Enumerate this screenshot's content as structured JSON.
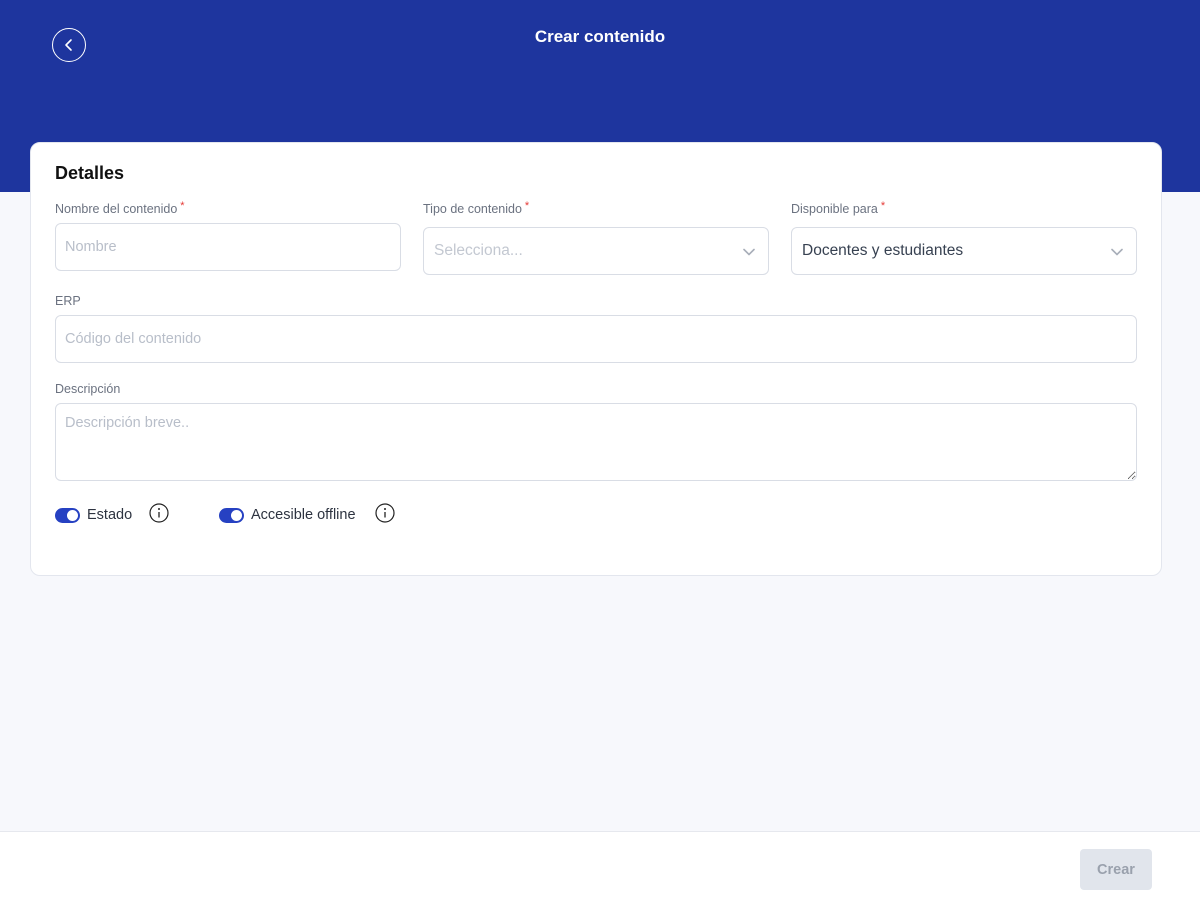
{
  "header": {
    "title": "Crear contenido",
    "back_icon": "chevron-left-icon",
    "background_color": "#1e359e"
  },
  "card": {
    "section_title": "Detalles",
    "fields": {
      "nombre": {
        "label": "Nombre del contenido",
        "required_mark": "*",
        "placeholder": "Nombre",
        "value": ""
      },
      "tipo": {
        "label": "Tipo de contenido",
        "required_mark": "*",
        "placeholder": "Selecciona...",
        "icon": "chevron-down-icon"
      },
      "disponible": {
        "label": "Disponible para",
        "required_mark": "*",
        "value": "Docentes y estudiantes",
        "icon": "chevron-down-icon"
      },
      "erp": {
        "label": "ERP",
        "placeholder": "Código del contenido",
        "value": ""
      },
      "descripcion": {
        "label": "Descripción",
        "placeholder": "Descripción breve..",
        "value": ""
      }
    },
    "toggles": [
      {
        "label": "Estado",
        "on": true,
        "info_icon": "info-icon"
      },
      {
        "label": "Accesible offline",
        "on": true,
        "info_icon": "info-icon"
      }
    ]
  },
  "footer": {
    "create_label": "Crear",
    "create_enabled": false
  },
  "colors": {
    "accent": "#2641c2",
    "required": "#e53935",
    "page_background": "#f7f8fc"
  }
}
